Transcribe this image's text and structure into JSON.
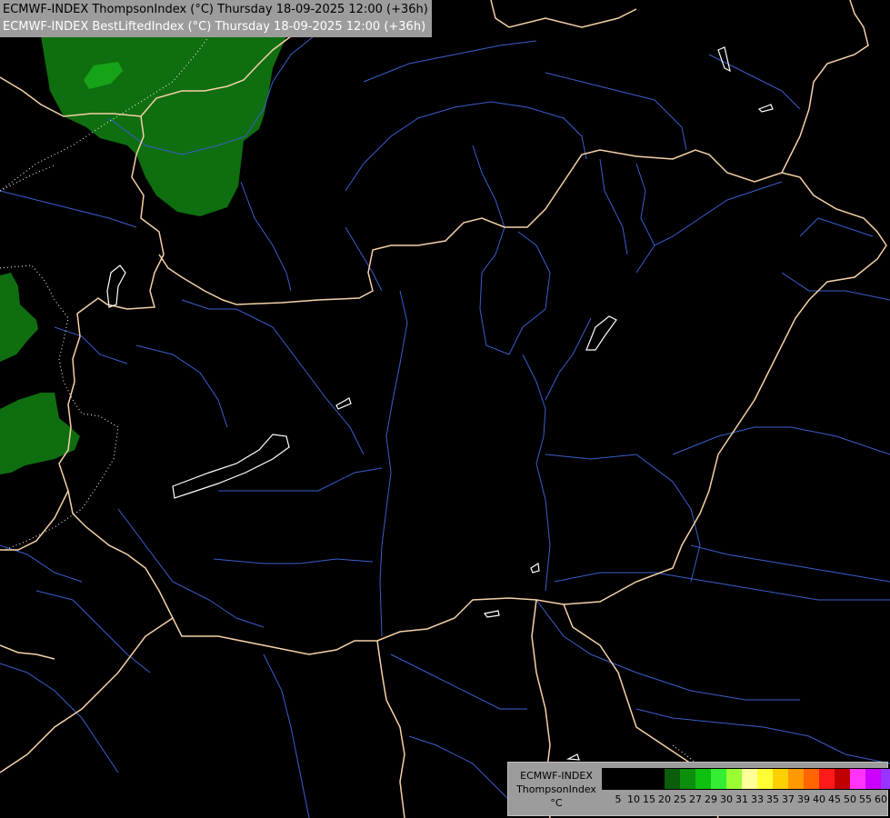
{
  "header": {
    "line1": "ECMWF-INDEX ThompsonIndex (°C) Thursday 18-09-2025 12:00 (+36h)",
    "line2": "ECMWF-INDEX BestLiftedIndex (°C) Thursday 18-09-2025 12:00 (+36h)"
  },
  "legend": {
    "label_line1": "ECMWF-INDEX",
    "label_line2": "ThompsonIndex",
    "label_line3": "°C",
    "colors": [
      "#000000",
      "#000000",
      "#000000",
      "#000000",
      "#0b5d0b",
      "#0c8f0c",
      "#10c010",
      "#33ee33",
      "#99ff33",
      "#ffff99",
      "#ffff33",
      "#ffd000",
      "#ff9900",
      "#ff6600",
      "#ff1a1a",
      "#c00000",
      "#ff33ff",
      "#cc00ff",
      "#9933ff",
      "#5a00ff",
      "#2323ff"
    ],
    "ticks": [
      "5",
      "10",
      "15",
      "20",
      "25",
      "27",
      "29",
      "30",
      "31",
      "33",
      "35",
      "37",
      "39",
      "40",
      "45",
      "50",
      "55",
      "60"
    ]
  },
  "map": {
    "background": "#000000",
    "border_color": "#f5d2a8",
    "river_color": "#3a5fcd",
    "lake_color": "#ffffff",
    "contour_color": "#ffffff",
    "fill_light": "#0f6e0f",
    "fill_bright": "#17a317"
  }
}
